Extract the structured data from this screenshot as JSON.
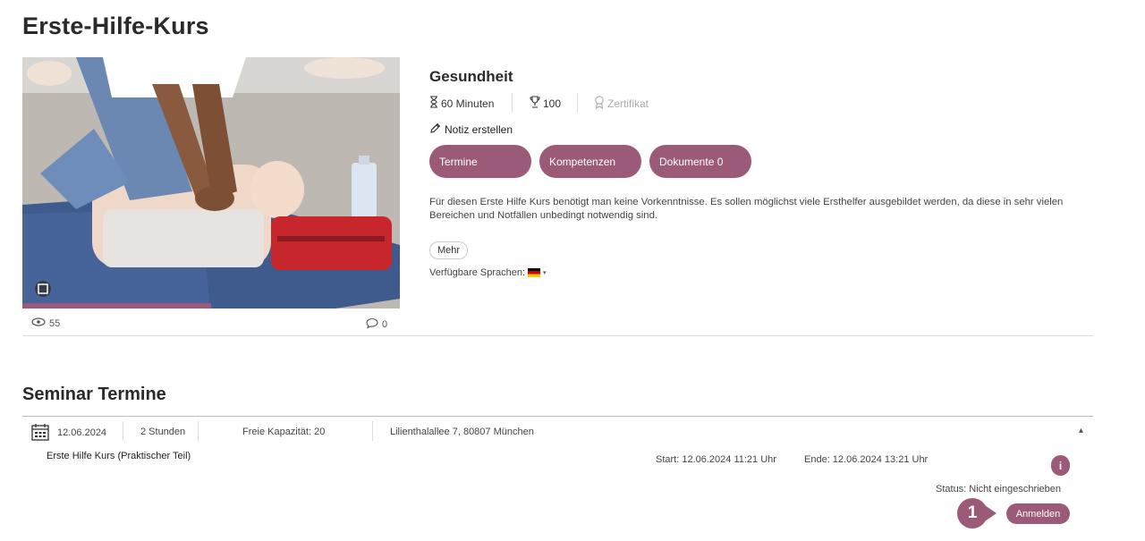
{
  "course": {
    "title": "Erste-Hilfe-Kurs",
    "views": "55",
    "comments": "0",
    "category": "Gesundheit",
    "duration": "60 Minuten",
    "points": "100",
    "certificate": "Zertifikat",
    "note_label": "Notiz erstellen",
    "tabs": [
      "Termine",
      "Kompetenzen",
      "Dokumente 0"
    ],
    "description": "Für diesen Erste Hilfe Kurs benötigt man keine Vorkenntnisse. Es sollen möglichst viele Ersthelfer ausgebildet werden, da diese in sehr vielen Bereichen und Notfällen unbedingt notwendig sind.",
    "more_label": "Mehr",
    "languages_label": "Verfügbare Sprachen:",
    "language_flag": "de-flag",
    "progress": 0.5
  },
  "seminar": {
    "section_title": "Seminar Termine",
    "date": "12.06.2024",
    "duration": "2 Stunden",
    "capacity": "Freie Kapazität: 20",
    "location": "Lilienthalallee 7, 80807 München",
    "name": "Erste Hilfe Kurs (Praktischer Teil)",
    "start": "Start: 12.06.2024 11:21 Uhr",
    "end": "Ende: 12.06.2024 13:21 Uhr",
    "info_label": "i",
    "status": "Status: Nicht eingeschrieben",
    "register_label": "Anmelden",
    "step_number": "1"
  },
  "colors": {
    "accent": "#9b5a77",
    "text": "#2b2b2b"
  }
}
